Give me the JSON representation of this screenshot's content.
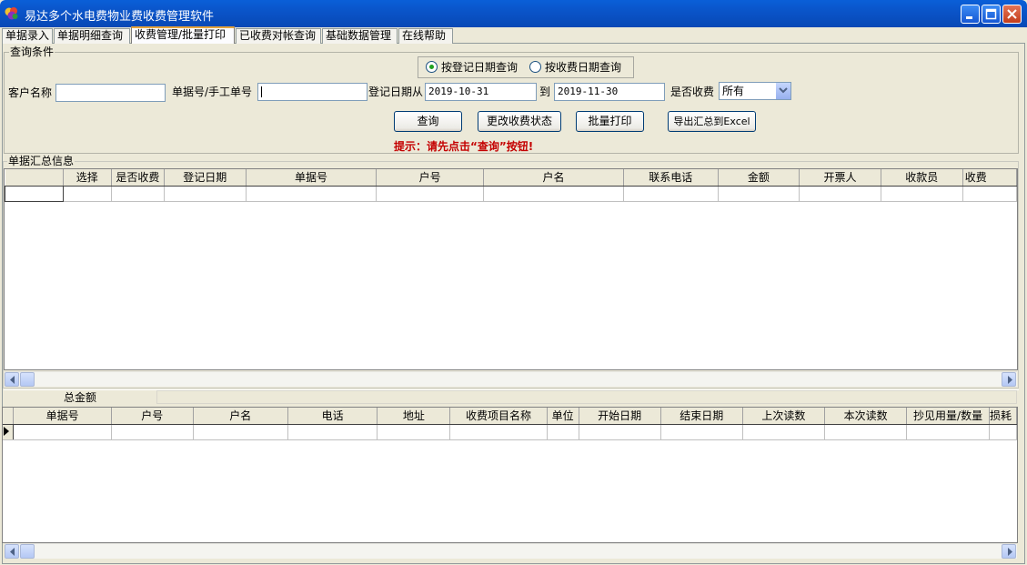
{
  "window": {
    "title": "易达多个水电费物业费收费管理软件"
  },
  "tabs": [
    "单据录入",
    "单据明细查询",
    "收费管理/批量打印",
    "已收费对帐查询",
    "基础数据管理",
    "在线帮助"
  ],
  "active_tab": "收费管理/批量打印",
  "query": {
    "group_title": "查询条件",
    "radio_by_register": "按登记日期查询",
    "radio_by_payment": "按收费日期查询",
    "selected_radio": "按登记日期查询",
    "customer_label": "客户名称",
    "customer_value": "",
    "bill_no_label": "单据号/手工单号",
    "bill_no_value": "",
    "date_from_label": "登记日期从",
    "date_from_value": "2019-10-31",
    "to_label": "到",
    "date_to_value": "2019-11-30",
    "paid_label": "是否收费",
    "paid_value": "所有",
    "btn_query": "查询",
    "btn_change_status": "更改收费状态",
    "btn_batch_print": "批量打印",
    "btn_export": "导出汇总到Excel",
    "hint": "提示：请先点击“查询”按钮!"
  },
  "summary": {
    "group_title": "单据汇总信息",
    "columns": [
      "选择",
      "是否收费",
      "登记日期",
      "单据号",
      "户号",
      "户名",
      "联系电话",
      "金额",
      "开票人",
      "收款员",
      "收费"
    ]
  },
  "total": {
    "label": "总金额",
    "value": ""
  },
  "detail": {
    "columns": [
      "单据号",
      "户号",
      "户名",
      "电话",
      "地址",
      "收费项目名称",
      "单位",
      "开始日期",
      "结束日期",
      "上次读数",
      "本次读数",
      "抄见用量/数量",
      "损耗"
    ]
  },
  "colors": {
    "title_bar": "#0a53c7",
    "hint": "#c40000",
    "window_bg": "#ece9d8",
    "tab_highlight": "#e6a53d"
  }
}
